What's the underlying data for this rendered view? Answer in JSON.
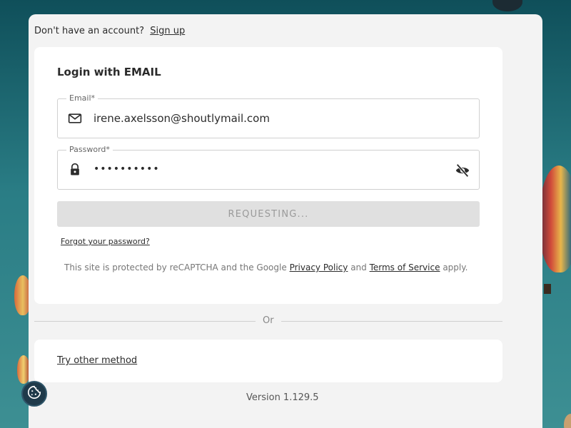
{
  "signup": {
    "prompt": "Don't have an account?",
    "link": "Sign up"
  },
  "login": {
    "title": "Login with EMAIL",
    "email_label": "Email*",
    "email_value": "irene.axelsson@shoutlymail.com",
    "password_label": "Password*",
    "password_value": "••••••••••",
    "submit_label": "REQUESTING...",
    "forgot_link": "Forgot your password?",
    "recaptcha_prefix": "This site is protected by reCAPTCHA and the Google",
    "privacy_link": "Privacy Policy",
    "recaptcha_and": "and",
    "terms_link": "Terms of Service",
    "recaptcha_suffix": "apply."
  },
  "divider": {
    "text": "Or"
  },
  "alt": {
    "try_other": "Try other method"
  },
  "footer": {
    "version": "Version 1.129.5"
  },
  "icons": {
    "email": "mail-icon",
    "password": "lock-icon",
    "toggle_visibility": "eye-off-icon",
    "cookie": "cookie-icon"
  },
  "colors": {
    "panel_bg": "#f3f3f3",
    "card_bg": "#ffffff",
    "button_disabled_bg": "#e0e0e0",
    "button_disabled_text": "#9a9a9a",
    "cookie_btn_bg": "#1f3a4a"
  }
}
